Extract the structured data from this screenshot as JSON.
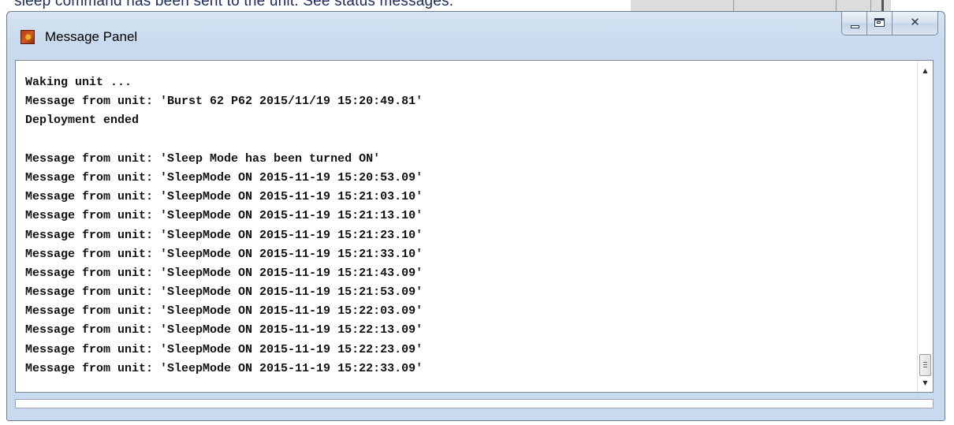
{
  "background": {
    "text": "sleep command has been sent to the unit. See status messages."
  },
  "window": {
    "title": "Message Panel",
    "controls": {
      "minimize_icon": "minimize-icon",
      "maximize_icon": "maximize-icon",
      "close_icon": "close-icon",
      "close_glyph": "✕"
    }
  },
  "messages": [
    "Waking unit ...",
    "Message from unit: 'Burst 62 P62 2015/11/19 15:20:49.81'",
    "Deployment ended",
    "",
    "Message from unit: 'Sleep Mode has been turned ON'",
    "Message from unit: 'SleepMode ON 2015-11-19 15:20:53.09'",
    "Message from unit: 'SleepMode ON 2015-11-19 15:21:03.10'",
    "Message from unit: 'SleepMode ON 2015-11-19 15:21:13.10'",
    "Message from unit: 'SleepMode ON 2015-11-19 15:21:23.10'",
    "Message from unit: 'SleepMode ON 2015-11-19 15:21:33.10'",
    "Message from unit: 'SleepMode ON 2015-11-19 15:21:43.09'",
    "Message from unit: 'SleepMode ON 2015-11-19 15:21:53.09'",
    "Message from unit: 'SleepMode ON 2015-11-19 15:22:03.09'",
    "Message from unit: 'SleepMode ON 2015-11-19 15:22:13.09'",
    "Message from unit: 'SleepMode ON 2015-11-19 15:22:23.09'",
    "Message from unit: 'SleepMode ON 2015-11-19 15:22:33.09'"
  ],
  "scrollbar": {
    "up_glyph": "▲",
    "down_glyph": "▼",
    "position": 1.0
  },
  "colors": {
    "titlebar": "#c9daee",
    "text": "#111111"
  }
}
